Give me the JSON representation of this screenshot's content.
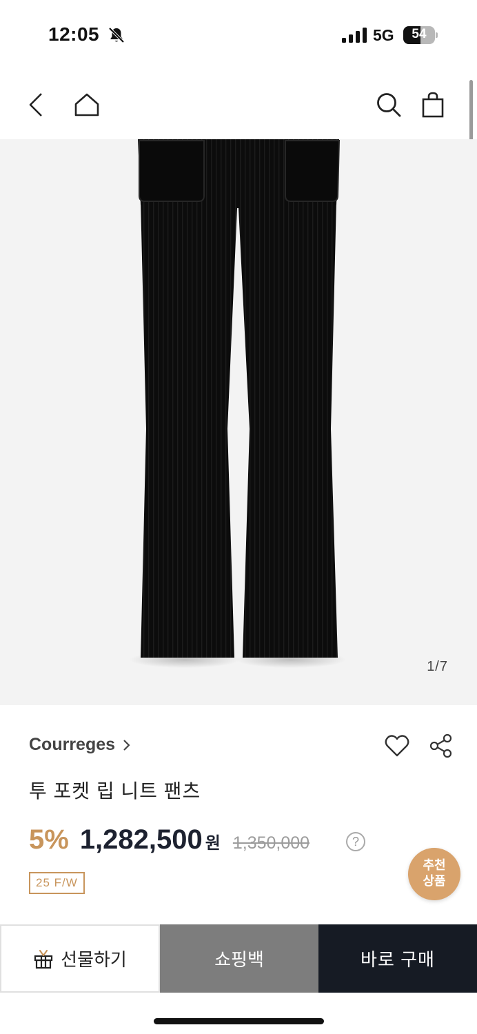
{
  "status_bar": {
    "time": "12:05",
    "network": "5G",
    "battery_level": "54",
    "battery_fraction": 0.54
  },
  "header": {
    "icons": [
      "back-chevron-icon",
      "home-icon",
      "search-icon",
      "shopping-bag-icon"
    ]
  },
  "gallery": {
    "page_indicator": "1/7"
  },
  "product": {
    "brand": "Courreges",
    "title": "투 포켓 립 니트 팬츠",
    "discount": "5%",
    "price": "1,282,500",
    "currency": "원",
    "original_price": "1,350,000",
    "help": "?",
    "season": "25 F/W"
  },
  "recommend": {
    "line1": "추천",
    "line2": "상품"
  },
  "actions": {
    "gift_label": "선물하기",
    "cart_label": "쇼핑백",
    "buy_label": "바로 구매"
  },
  "colors": {
    "accent": "#c8955c",
    "recommend_bg": "#d9a36c",
    "buy_bg": "#161b24",
    "cart_bg": "#7d7d7d"
  }
}
